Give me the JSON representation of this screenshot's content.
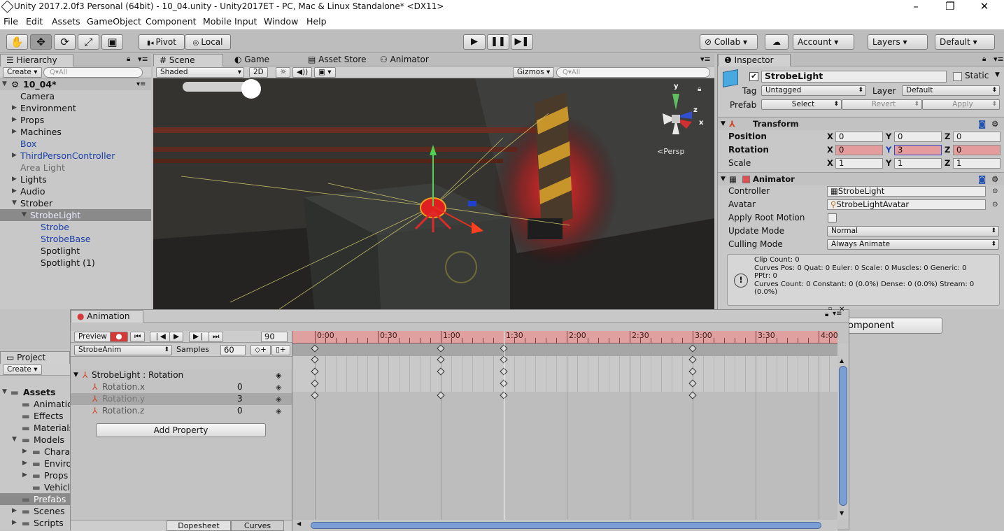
{
  "window": {
    "title": "Unity 2017.2.0f3 Personal (64bit) - 10_04.unity - Unity2017ET - PC, Mac & Linux Standalone* <DX11>",
    "minimize": "–",
    "maximize": "❐",
    "close": "✕"
  },
  "menu": [
    "File",
    "Edit",
    "Assets",
    "GameObject",
    "Component",
    "Mobile Input",
    "Window",
    "Help"
  ],
  "toolbar": {
    "tools": [
      "✋",
      "✥",
      "⟳",
      "⤢",
      "▣"
    ],
    "pivot": "Pivot",
    "local": "Local",
    "play": "▶",
    "pause": "❚❚",
    "step": "▶❚",
    "collab": "Collab",
    "cloud": "☁",
    "account": "Account",
    "layers": "Layers",
    "layout": "Default"
  },
  "hierarchy": {
    "tab": "Hierarchy",
    "create": "Create",
    "search": "Q▾All",
    "scene_name": "10_04*",
    "items": [
      {
        "label": "Camera",
        "indent": 1,
        "color": "",
        "expander": ""
      },
      {
        "label": "Environment",
        "indent": 1,
        "color": "",
        "expander": "▶"
      },
      {
        "label": "Props",
        "indent": 1,
        "color": "",
        "expander": "▶"
      },
      {
        "label": "Machines",
        "indent": 1,
        "color": "",
        "expander": "▶"
      },
      {
        "label": "Box",
        "indent": 1,
        "color": "blue",
        "expander": ""
      },
      {
        "label": "ThirdPersonController",
        "indent": 1,
        "color": "blue",
        "expander": "▶"
      },
      {
        "label": "Area Light",
        "indent": 1,
        "color": "grey",
        "expander": ""
      },
      {
        "label": "Lights",
        "indent": 1,
        "color": "",
        "expander": "▶"
      },
      {
        "label": "Audio",
        "indent": 1,
        "color": "",
        "expander": "▶"
      },
      {
        "label": "Strober",
        "indent": 1,
        "color": "",
        "expander": "▼"
      },
      {
        "label": "StrobeLight",
        "indent": 2,
        "color": "selected",
        "expander": "▼"
      },
      {
        "label": "Strobe",
        "indent": 3,
        "color": "blue",
        "expander": ""
      },
      {
        "label": "StrobeBase",
        "indent": 3,
        "color": "blue",
        "expander": ""
      },
      {
        "label": "Spotlight",
        "indent": 3,
        "color": "",
        "expander": ""
      },
      {
        "label": "Spotlight (1)",
        "indent": 3,
        "color": "",
        "expander": ""
      }
    ]
  },
  "scene": {
    "tabs": [
      "Scene",
      "Game",
      "Asset Store",
      "Animator"
    ],
    "shading": "Shaded",
    "mode_2d": "2D",
    "gizmos": "Gizmos",
    "search": "Q▾All",
    "persp": "<Persp",
    "gizmo_axes": [
      "y",
      "z",
      "x"
    ]
  },
  "inspector": {
    "tab": "Inspector",
    "object_name": "StrobeLight",
    "static": "Static",
    "tag_label": "Tag",
    "tag": "Untagged",
    "layer_label": "Layer",
    "layer": "Default",
    "prefab_label": "Prefab",
    "prefab_buttons": [
      "Select",
      "Revert",
      "Apply"
    ],
    "transform": {
      "title": "Transform",
      "rows": [
        {
          "label": "Position",
          "x": "0",
          "y": "0",
          "z": "0"
        },
        {
          "label": "Rotation",
          "x": "0",
          "y": "3",
          "z": "0"
        },
        {
          "label": "Scale",
          "x": "1",
          "y": "1",
          "z": "1"
        }
      ]
    },
    "animator": {
      "title": "Animator",
      "controller_label": "Controller",
      "controller": "StrobeLight",
      "avatar_label": "Avatar",
      "avatar": "StrobeLightAvatar",
      "root_motion_label": "Apply Root Motion",
      "update_mode_label": "Update Mode",
      "update_mode": "Normal",
      "culling_mode_label": "Culling Mode",
      "culling_mode": "Always Animate",
      "info": [
        "Clip Count: 0",
        "Curves Pos: 0 Quat: 0 Euler: 0 Scale: 0 Muscles: 0 Generic: 0",
        "PPtr: 0",
        "Curves Count: 0 Constant: 0 (0.0%) Dense: 0 (0.0%) Stream: 0",
        "(0.0%)"
      ]
    },
    "add_component": "omponent"
  },
  "animation": {
    "tab": "Animation",
    "preview": "Preview",
    "frame": "90",
    "clip": "StrobeAnim",
    "samples_label": "Samples",
    "samples": "60",
    "property_group": "StrobeLight : Rotation",
    "properties": [
      {
        "name": "Rotation.x",
        "value": "0"
      },
      {
        "name": "Rotation.y",
        "value": "3"
      },
      {
        "name": "Rotation.z",
        "value": "0"
      }
    ],
    "add_property": "Add Property",
    "bottom_tabs": [
      "Dopesheet",
      "Curves"
    ],
    "time_labels": [
      "0:00",
      "0:30",
      "1:00",
      "1:30",
      "2:00",
      "2:30",
      "3:00",
      "3:30",
      "4:00"
    ],
    "playhead_time": "1:30",
    "keyframes": {
      "summary": [
        "0:00",
        "1:00",
        "1:30",
        "3:00"
      ],
      "group": [
        "0:00",
        "1:00",
        "1:30",
        "3:00"
      ],
      "Rotation.x": [
        "0:00",
        "1:00",
        "1:30",
        "3:00"
      ],
      "Rotation.y": [
        "0:00",
        "1:30",
        "3:00"
      ],
      "Rotation.z": [
        "0:00",
        "1:00",
        "1:30",
        "3:00"
      ]
    }
  },
  "project": {
    "tab": "Project",
    "create": "Create",
    "assets_root": "Assets",
    "folders": [
      {
        "label": "Animatio",
        "indent": 1,
        "expander": ""
      },
      {
        "label": "Effects",
        "indent": 1,
        "expander": ""
      },
      {
        "label": "Materials",
        "indent": 1,
        "expander": ""
      },
      {
        "label": "Models",
        "indent": 1,
        "expander": "▼"
      },
      {
        "label": "Chara",
        "indent": 2,
        "expander": "▶"
      },
      {
        "label": "Enviro",
        "indent": 2,
        "expander": "▶"
      },
      {
        "label": "Props",
        "indent": 2,
        "expander": "▶"
      },
      {
        "label": "Vehicl",
        "indent": 2,
        "expander": ""
      },
      {
        "label": "Prefabs",
        "indent": 1,
        "expander": ""
      },
      {
        "label": "Scenes",
        "indent": 1,
        "expander": "▶"
      },
      {
        "label": "Scripts",
        "indent": 1,
        "expander": "▶"
      }
    ]
  },
  "colors": {
    "record_red": "#d33a3a",
    "timeline_red": "#e0a0a0",
    "selected_row": "#8a8a8a",
    "blue_text": "#1b3fa8"
  }
}
